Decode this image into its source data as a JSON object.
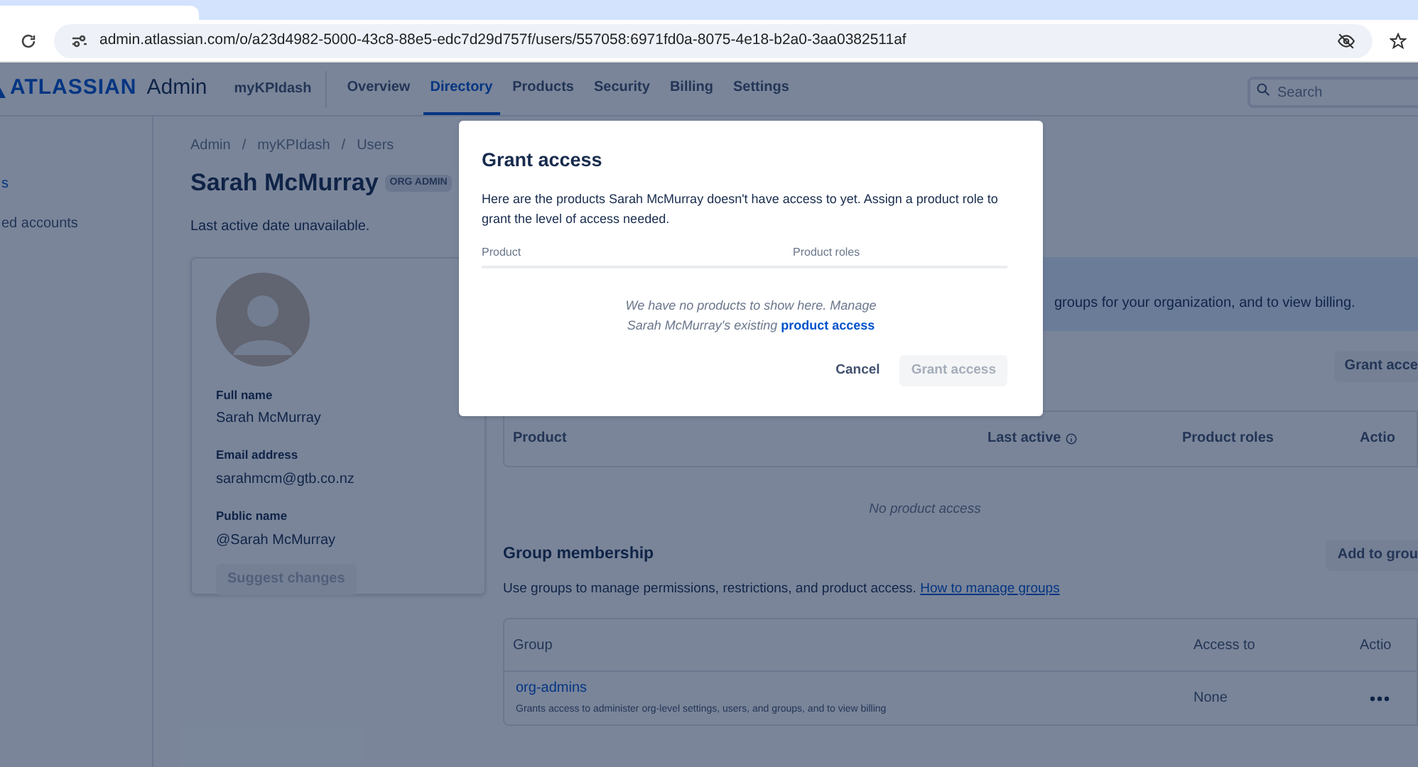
{
  "browser": {
    "url": "admin.atlassian.com/o/a23d4982-5000-43c8-88e5-edc7d29d757f/users/557058:6971fd0a-8075-4e18-b2a0-3aa0382511af"
  },
  "nav": {
    "logo": "ATLASSIAN",
    "product": "Admin",
    "site": "myKPIdash",
    "items": [
      {
        "label": "Overview",
        "selected": false
      },
      {
        "label": "Directory",
        "selected": true
      },
      {
        "label": "Products",
        "selected": false
      },
      {
        "label": "Security",
        "selected": false
      },
      {
        "label": "Billing",
        "selected": false
      },
      {
        "label": "Settings",
        "selected": false
      }
    ],
    "search": {
      "placeholder": "Search"
    }
  },
  "sidebar": {
    "items": [
      {
        "label": "s",
        "selected": true
      },
      {
        "label": "ed accounts",
        "selected": false
      }
    ]
  },
  "breadcrumbs": [
    "Admin",
    "myKPIdash",
    "Users"
  ],
  "breadcrumb_separator": "/",
  "user": {
    "name": "Sarah McMurray",
    "badge": "ORG ADMIN",
    "last_active": "Last active date unavailable.",
    "fields": [
      {
        "label": "Full name",
        "value": "Sarah McMurray"
      },
      {
        "label": "Email address",
        "value": "sarahmcm@gtb.co.nz"
      },
      {
        "label": "Public name",
        "value": "@Sarah McMurray"
      }
    ],
    "suggest_button": "Suggest changes"
  },
  "banner": {
    "text": "groups for your organization, and to view billing."
  },
  "products": {
    "button": "Grant acce",
    "columns": [
      "Product",
      "Last active",
      "Product roles",
      "Actio"
    ],
    "empty": "No product access"
  },
  "groups": {
    "title": "Group membership",
    "button": "Add to grou",
    "description": "Use groups to manage permissions, restrictions, and product access.",
    "link": "How to manage groups",
    "columns": [
      "Group",
      "Access to",
      "Actio"
    ],
    "rows": [
      {
        "name": "org-admins",
        "description": "Grants access to administer org-level settings, users, and groups, and to view billing",
        "access": "None"
      }
    ]
  },
  "modal": {
    "title": "Grant access",
    "text": "Here are the products Sarah McMurray doesn't have access to yet. Assign a product role to grant the level of access needed.",
    "columns": [
      "Product",
      "Product roles"
    ],
    "empty_text": "We have no products to show here. Manage Sarah McMurray's existing",
    "empty_link": "product access",
    "cancel": "Cancel",
    "grant": {
      "label": "Grant access",
      "disabled": true
    }
  }
}
